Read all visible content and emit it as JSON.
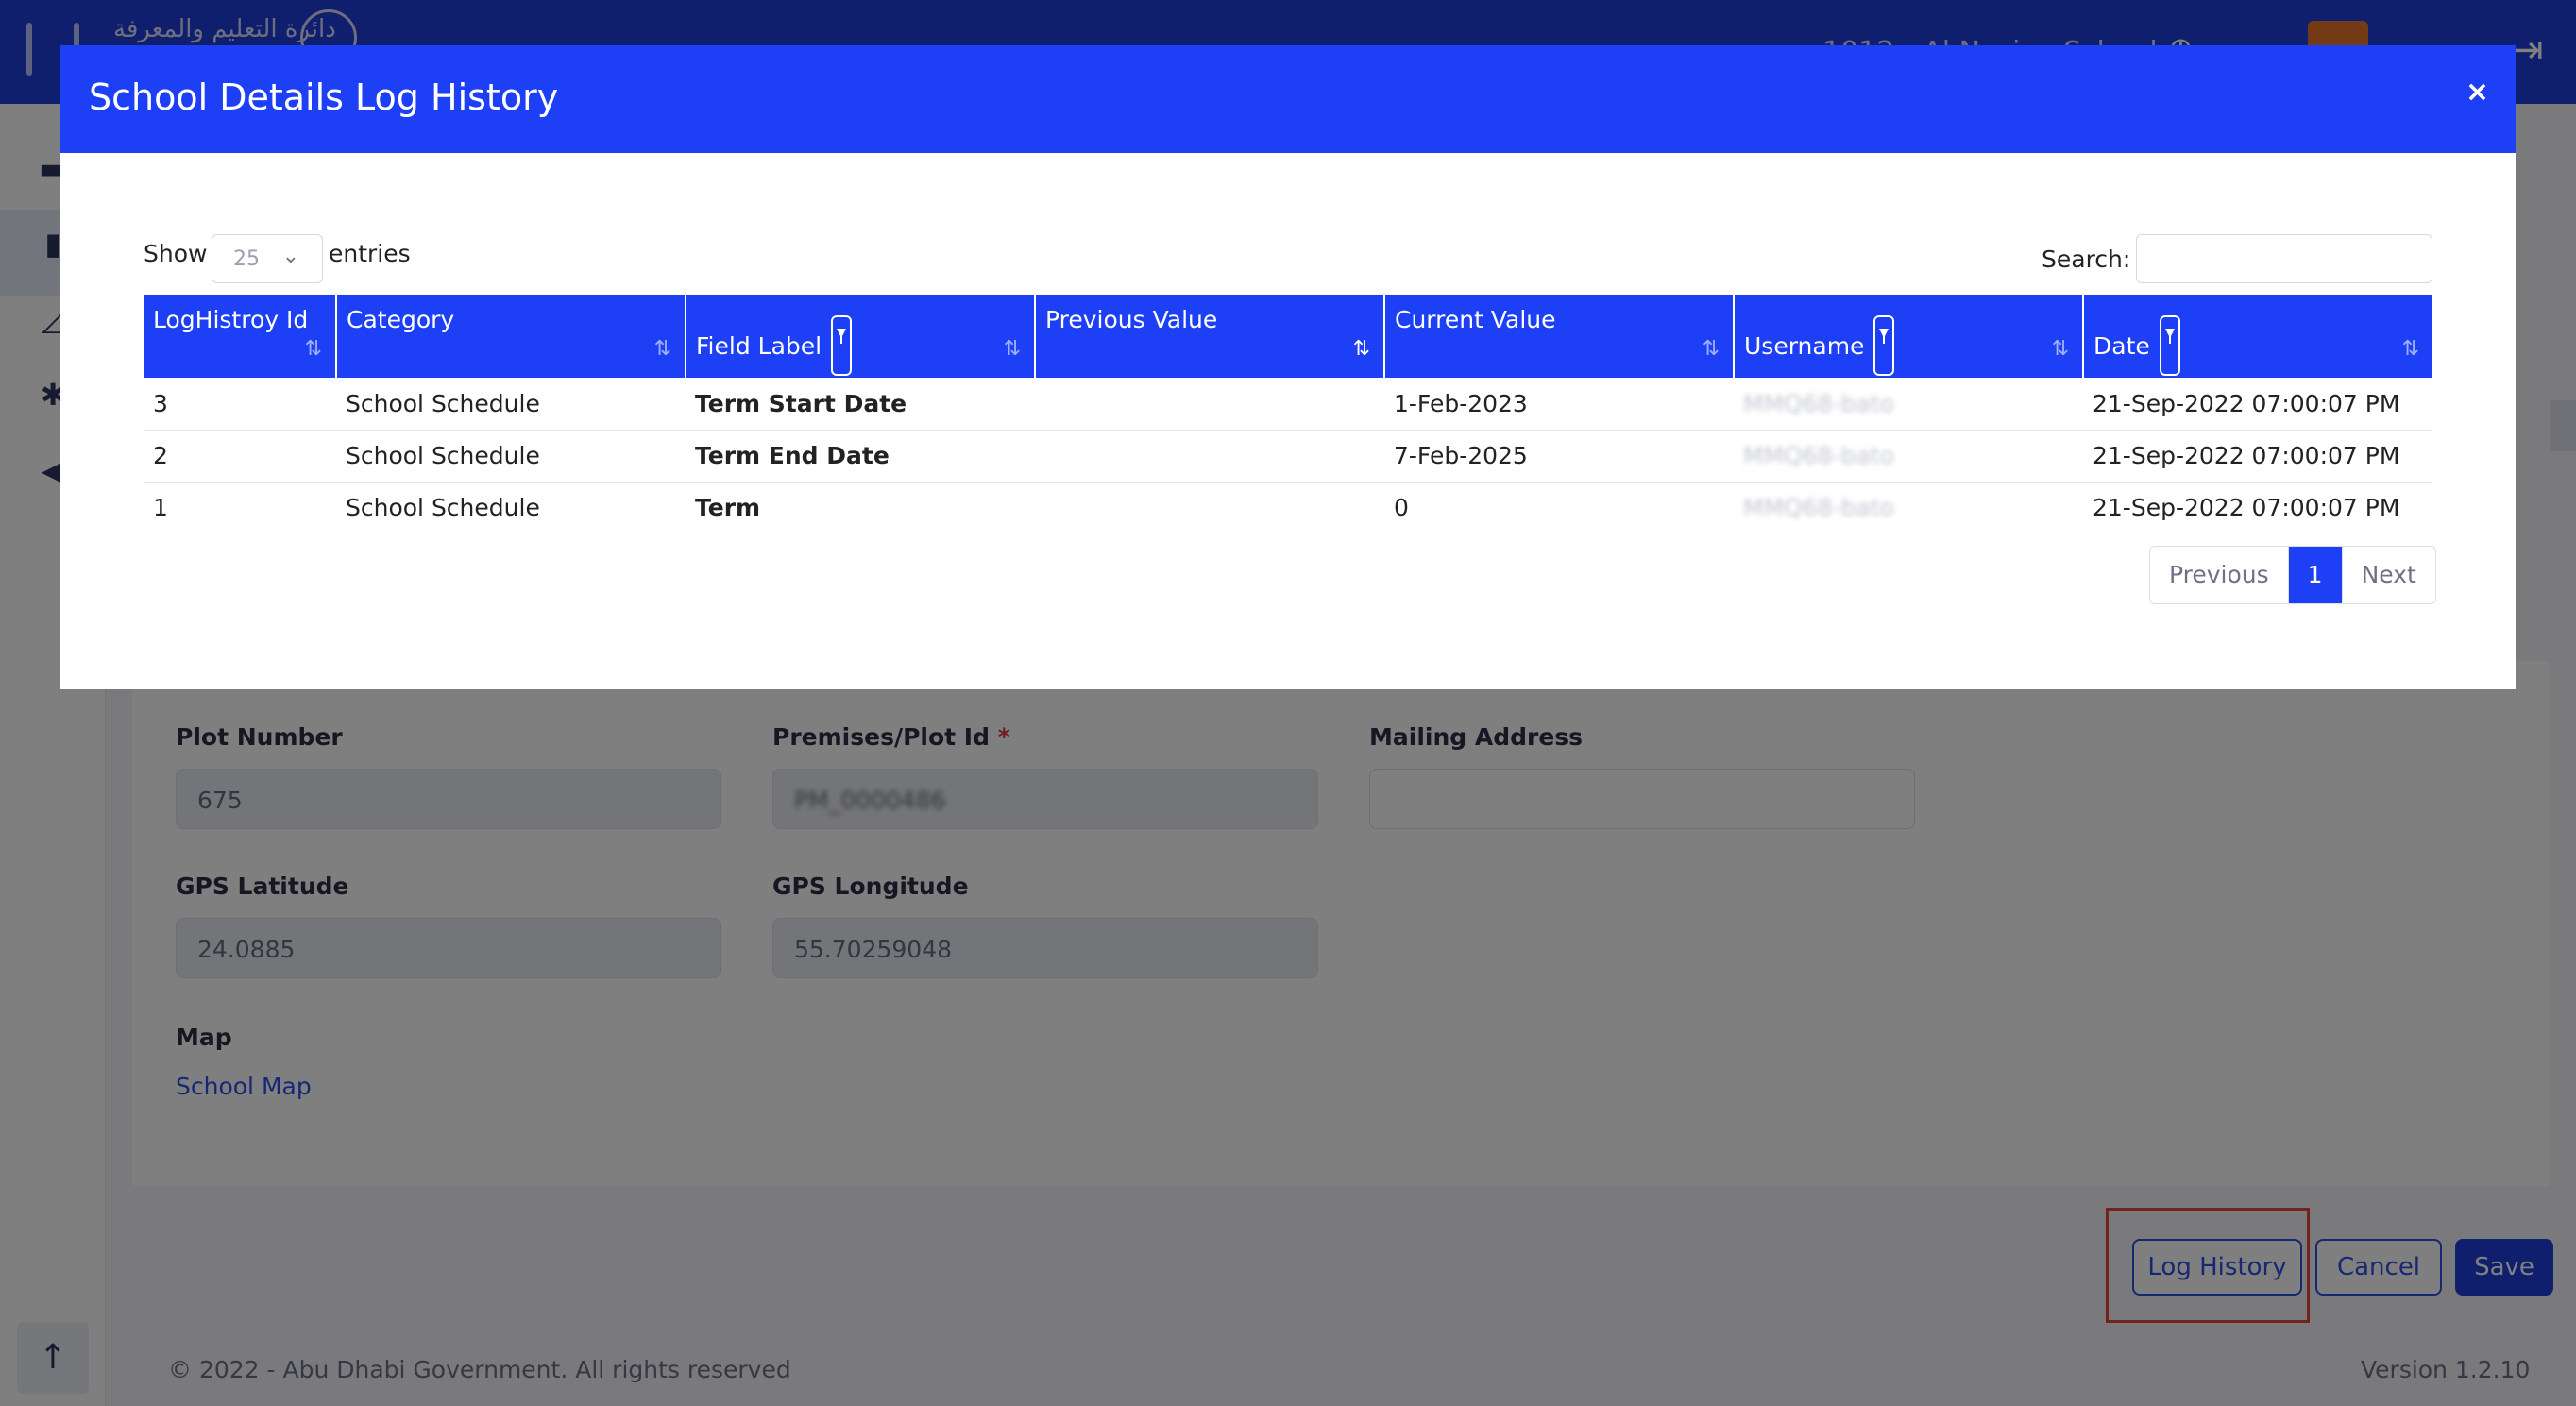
{
  "app": {
    "logo_text": "دائرة التعليم والمعرفة",
    "school_name": "1012 - Al Nasiya School"
  },
  "form": {
    "plot_number": {
      "label": "Plot Number",
      "value": "675"
    },
    "premises_plot_id": {
      "label": "Premises/Plot Id",
      "value": "PM_0000486"
    },
    "mailing_address": {
      "label": "Mailing Address",
      "value": ""
    },
    "gps_latitude": {
      "label": "GPS Latitude",
      "value": "24.0885"
    },
    "gps_longitude": {
      "label": "GPS Longitude",
      "value": "55.70259048"
    },
    "map_label": "Map",
    "map_link": "School Map"
  },
  "actions": {
    "log_history": "Log History",
    "cancel": "Cancel",
    "save": "Save"
  },
  "footer": {
    "copyright": "© 2022 - Abu Dhabi Government. All rights reserved",
    "version": "Version 1.2.10"
  },
  "modal": {
    "title": "School Details Log History",
    "close": "×",
    "show_label": "Show",
    "entries_value": "25",
    "entries_label": "entries",
    "search_label": "Search:",
    "search_value": "",
    "columns": [
      "LogHistroy Id",
      "Category",
      "Field Label",
      "Previous Value",
      "Current Value",
      "Username",
      "Date"
    ],
    "rows": [
      {
        "id": "3",
        "category": "School Schedule",
        "field_label": "Term Start Date",
        "previous_value": "",
        "current_value": "1-Feb-2023",
        "username": "MMQ68-bato",
        "date": "21-Sep-2022 07:00:07 PM"
      },
      {
        "id": "2",
        "category": "School Schedule",
        "field_label": "Term End Date",
        "previous_value": "",
        "current_value": "7-Feb-2025",
        "username": "MMQ68-bato",
        "date": "21-Sep-2022 07:00:07 PM"
      },
      {
        "id": "1",
        "category": "School Schedule",
        "field_label": "Term",
        "previous_value": "",
        "current_value": "0",
        "username": "MMQ68-bato",
        "date": "21-Sep-2022 07:00:07 PM"
      }
    ],
    "pagination": {
      "previous": "Previous",
      "current": "1",
      "next": "Next"
    }
  },
  "colors": {
    "primary": "#1d3ff5",
    "header_bar": "#1e3fdc",
    "highlight_border": "#e2473f"
  }
}
